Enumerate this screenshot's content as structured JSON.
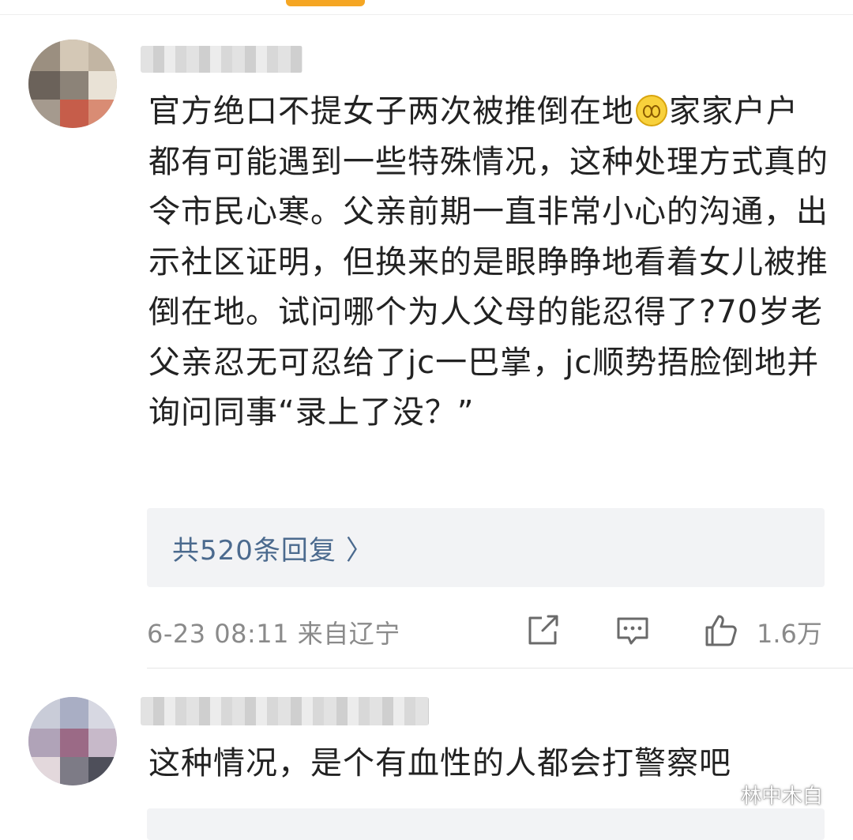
{
  "comments": [
    {
      "username": "",
      "text_before_emoji": "官方绝口不提女子两次被推倒在地",
      "emoji": "smiling-face-emoji",
      "text_after_emoji": "家家户户都有可能遇到一些特殊情况，这种处理方式真的令市民心寒。父亲前期一直非常小心的沟通，出示社区证明，但换来的是眼睁睁地看着女儿被推倒在地。试问哪个为人父母的能忍得了?70岁老父亲忍无可忍给了jc一巴掌，jc顺势捂脸倒地并询问同事“录上了没？”",
      "replies_label": "共520条回复",
      "replies_chevron": "〉",
      "timestamp": "6-23 08:11 来自辽宁",
      "like_count": "1.6万",
      "icons": {
        "share": "share-icon",
        "comment": "comment-icon",
        "like": "thumbs-up-icon"
      }
    },
    {
      "username": "",
      "text": "这种情况，是个有血性的人都会打警察吧"
    }
  ],
  "watermark": {
    "text": "林中木白",
    "icon": "wechat-icon"
  },
  "colors": {
    "accent": "#f5a623",
    "link": "#4b6a8e",
    "muted": "#8a8a8a",
    "reply_bg": "#f2f3f5"
  }
}
